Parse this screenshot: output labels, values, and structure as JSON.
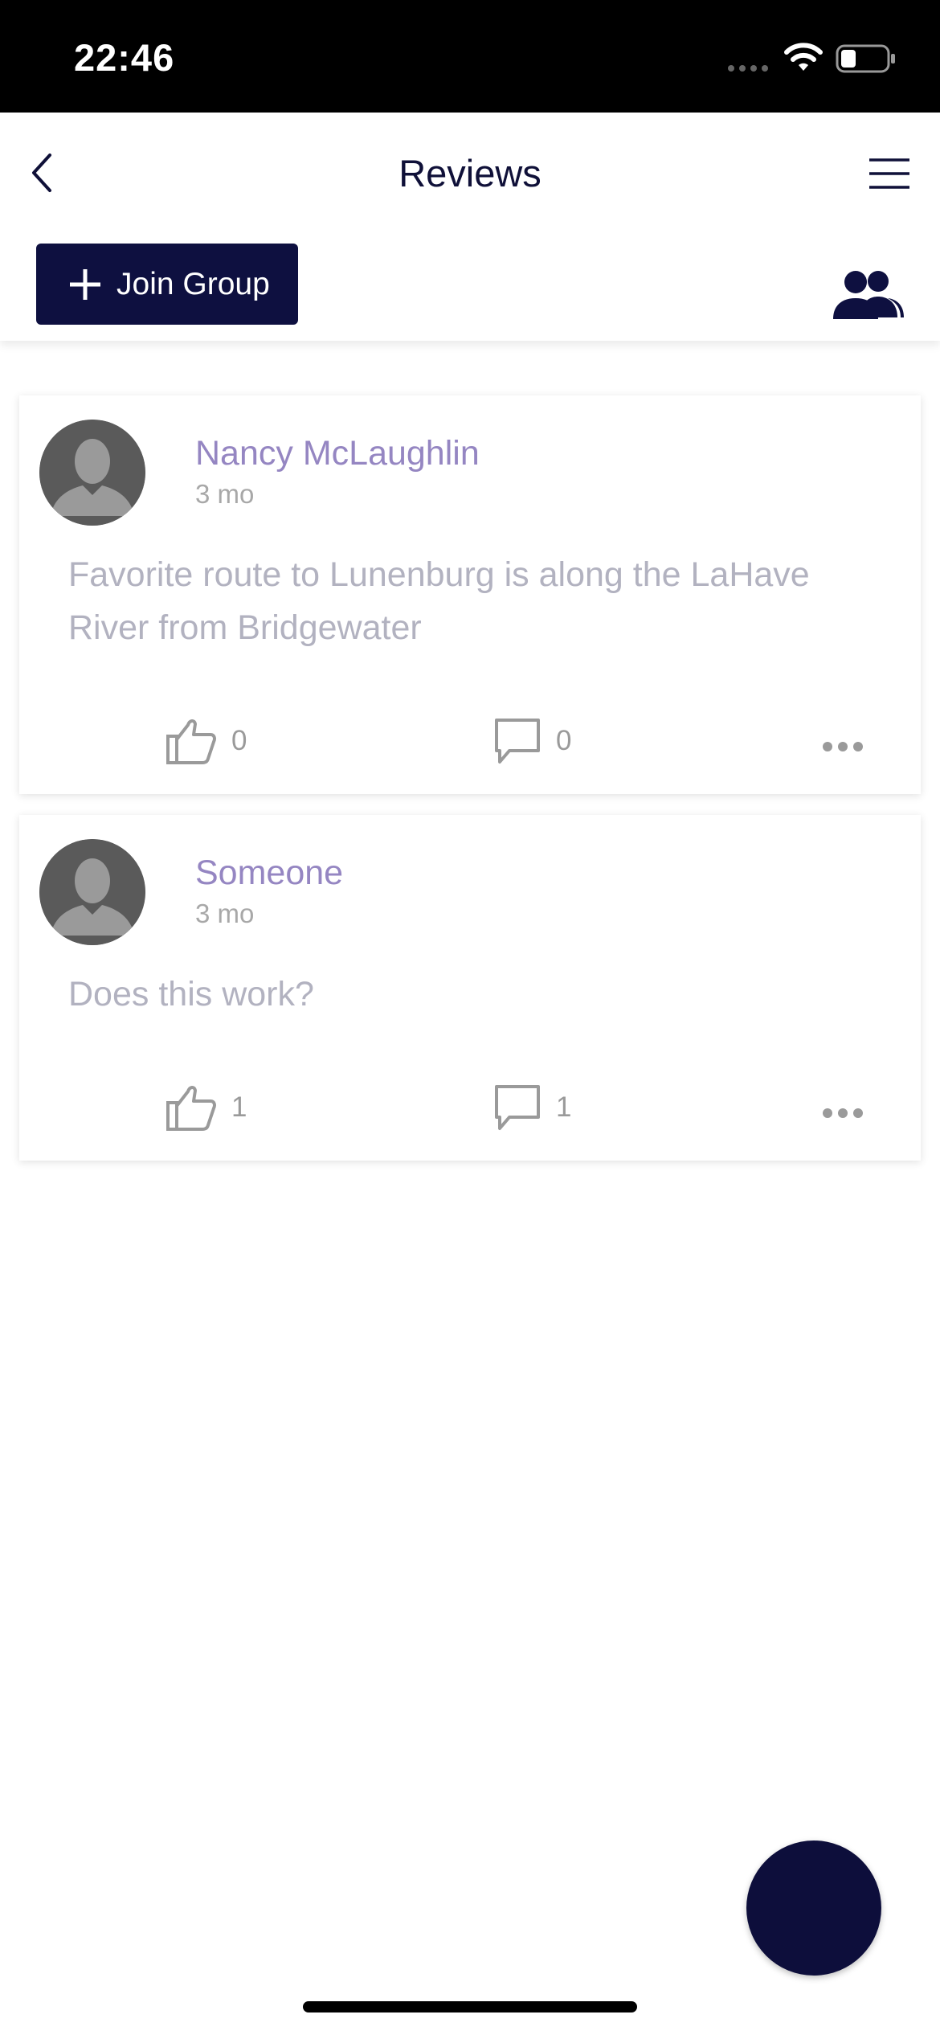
{
  "status_bar": {
    "time": "22:46"
  },
  "header": {
    "title": "Reviews",
    "join_button_label": "Join Group"
  },
  "posts": [
    {
      "author": "Nancy McLaughlin",
      "time": "3 mo",
      "body": "Favorite route to Lunenburg is along the LaHave River from Bridgewater",
      "likes": "0",
      "comments": "0"
    },
    {
      "author": "Someone",
      "time": "3 mo",
      "body": "Does this work?",
      "likes": "1",
      "comments": "1"
    }
  ],
  "colors": {
    "primary_navy": "#0e1040",
    "author_purple": "#9586c2",
    "body_text": "#b2b2c0",
    "meta_gray": "#a8a8a8"
  },
  "icons": {
    "back": "chevron-left-icon",
    "menu": "hamburger-menu-icon",
    "join": "plus-icon",
    "group": "group-people-icon",
    "like": "thumbs-up-icon",
    "comment": "comment-bubble-icon",
    "more": "more-horizontal-icon",
    "avatar": "default-user-avatar-icon"
  }
}
